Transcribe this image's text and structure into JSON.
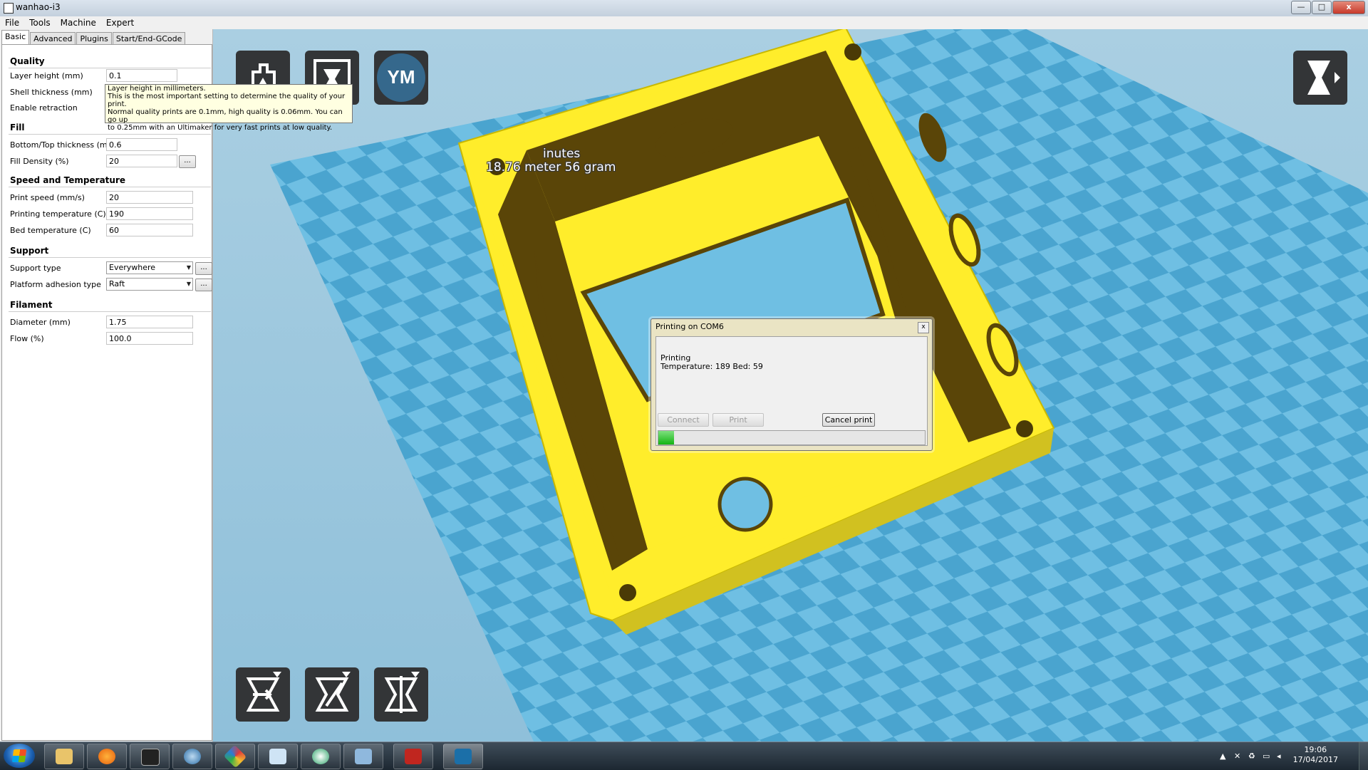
{
  "window": {
    "title": "wanhao-i3",
    "min_label": "—",
    "max_label": "□",
    "close_label": "x"
  },
  "menu": [
    "File",
    "Tools",
    "Machine",
    "Expert"
  ],
  "tabs": [
    "Basic",
    "Advanced",
    "Plugins",
    "Start/End-GCode"
  ],
  "sections": {
    "quality": {
      "title": "Quality",
      "layer_height": {
        "label": "Layer height (mm)",
        "value": "0.1"
      },
      "shell_thickness": {
        "label": "Shell thickness (mm)"
      },
      "enable_retraction": {
        "label": "Enable retraction"
      }
    },
    "fill": {
      "title": "Fill",
      "bottom_top": {
        "label": "Bottom/Top thickness (mm)",
        "value": "0.6"
      },
      "density": {
        "label": "Fill Density (%)",
        "value": "20"
      }
    },
    "speed": {
      "title": "Speed and Temperature",
      "print_speed": {
        "label": "Print speed (mm/s)",
        "value": "20"
      },
      "print_temp": {
        "label": "Printing temperature (C)",
        "value": "190"
      },
      "bed_temp": {
        "label": "Bed temperature (C)",
        "value": "60"
      }
    },
    "support": {
      "title": "Support",
      "type": {
        "label": "Support type",
        "value": "Everywhere"
      },
      "adhesion": {
        "label": "Platform adhesion type",
        "value": "Raft"
      }
    },
    "filament": {
      "title": "Filament",
      "diameter": {
        "label": "Diameter (mm)",
        "value": "1.75"
      },
      "flow": {
        "label": "Flow (%)",
        "value": "100.0"
      }
    },
    "more_button": "..."
  },
  "tooltip": {
    "lines": [
      "Layer height in millimeters.",
      "This is the most important setting to determine the quality of your print.",
      "Normal quality prints are 0.1mm, high quality is 0.06mm. You can go up",
      "to 0.25mm with an Ultimaker for very fast prints at low quality."
    ]
  },
  "viewport": {
    "stats_line1": "inutes",
    "stats_line2": "18.76 meter 56 gram",
    "ym_label": "YM"
  },
  "dialog": {
    "title": "Printing on COM6",
    "status_line1": "Printing",
    "status_line2": "Temperature: 189 Bed: 59",
    "connect_label": "Connect",
    "print_label": "Print",
    "cancel_label": "Cancel print",
    "close_label": "x",
    "progress": 0.06
  },
  "taskbar": {
    "time": "19:06",
    "date": "17/04/2017"
  },
  "colors": {
    "bed_light": "#6fbfe3",
    "bed_dark": "#4aa4cf",
    "model_yellow": "#ffed2b",
    "model_dark": "#5a4508",
    "progress_green": "#22c022"
  }
}
